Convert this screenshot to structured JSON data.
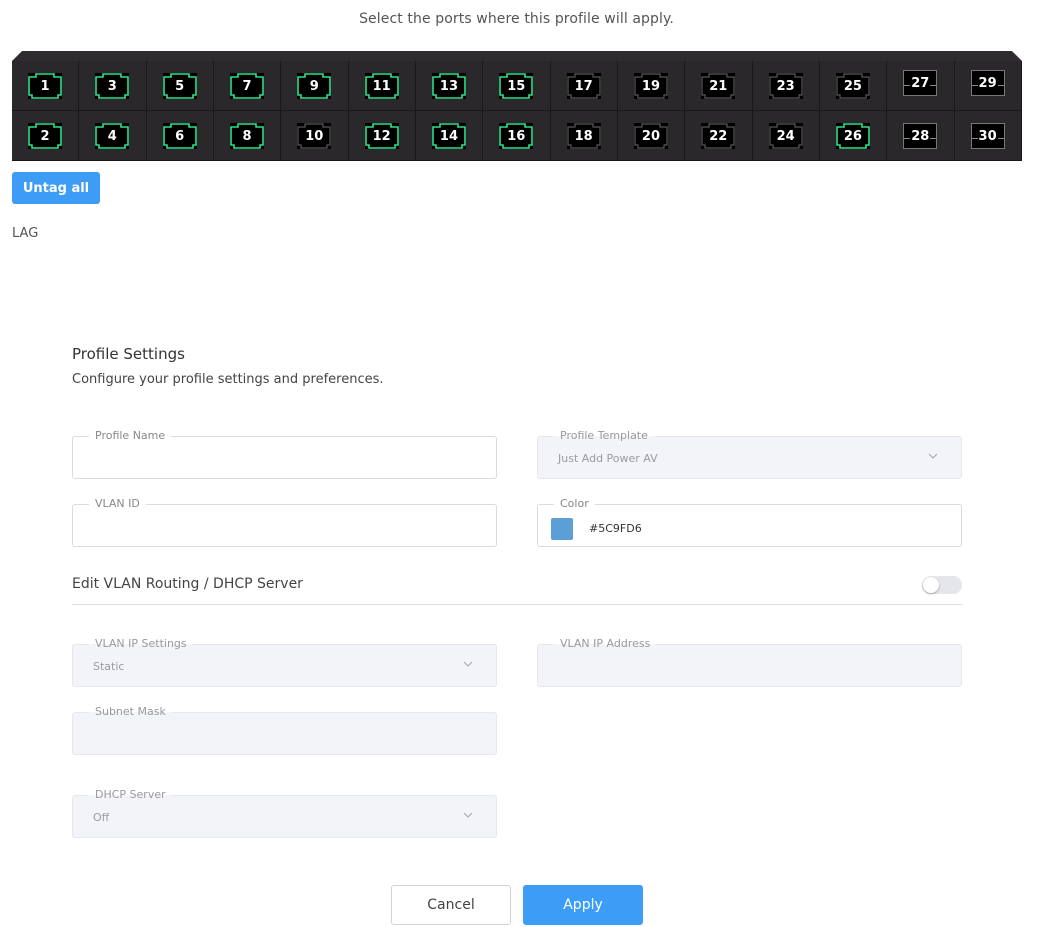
{
  "header": {
    "instruction": "Select the ports where this profile will apply."
  },
  "ports": {
    "top_row": [
      {
        "label": "1",
        "selected": true,
        "kind": "rj45"
      },
      {
        "label": "3",
        "selected": true,
        "kind": "rj45"
      },
      {
        "label": "5",
        "selected": true,
        "kind": "rj45"
      },
      {
        "label": "7",
        "selected": true,
        "kind": "rj45"
      },
      {
        "label": "9",
        "selected": true,
        "kind": "rj45"
      },
      {
        "label": "11",
        "selected": true,
        "kind": "rj45"
      },
      {
        "label": "13",
        "selected": true,
        "kind": "rj45"
      },
      {
        "label": "15",
        "selected": true,
        "kind": "rj45"
      },
      {
        "label": "17",
        "selected": false,
        "kind": "rj45"
      },
      {
        "label": "19",
        "selected": false,
        "kind": "rj45"
      },
      {
        "label": "21",
        "selected": false,
        "kind": "rj45"
      },
      {
        "label": "23",
        "selected": false,
        "kind": "rj45"
      },
      {
        "label": "25",
        "selected": false,
        "kind": "rj45"
      },
      {
        "label": "27",
        "selected": false,
        "kind": "sfp"
      },
      {
        "label": "29",
        "selected": false,
        "kind": "sfp"
      }
    ],
    "bottom_row": [
      {
        "label": "2",
        "selected": true,
        "kind": "rj45"
      },
      {
        "label": "4",
        "selected": true,
        "kind": "rj45"
      },
      {
        "label": "6",
        "selected": true,
        "kind": "rj45"
      },
      {
        "label": "8",
        "selected": true,
        "kind": "rj45"
      },
      {
        "label": "10",
        "selected": false,
        "kind": "rj45"
      },
      {
        "label": "12",
        "selected": true,
        "kind": "rj45"
      },
      {
        "label": "14",
        "selected": true,
        "kind": "rj45"
      },
      {
        "label": "16",
        "selected": true,
        "kind": "rj45"
      },
      {
        "label": "18",
        "selected": false,
        "kind": "rj45"
      },
      {
        "label": "20",
        "selected": false,
        "kind": "rj45"
      },
      {
        "label": "22",
        "selected": false,
        "kind": "rj45"
      },
      {
        "label": "24",
        "selected": false,
        "kind": "rj45"
      },
      {
        "label": "26",
        "selected": true,
        "kind": "rj45"
      },
      {
        "label": "28",
        "selected": false,
        "kind": "sfp"
      },
      {
        "label": "30",
        "selected": false,
        "kind": "sfp"
      }
    ],
    "selected_color": "#2ee08a",
    "unselected_color": "#5a585a"
  },
  "actions": {
    "untag_all_label": "Untag all"
  },
  "lag": {
    "label": "LAG"
  },
  "profile_settings": {
    "title": "Profile Settings",
    "subtitle": "Configure your profile settings and preferences.",
    "profile_name": {
      "label": "Profile Name",
      "value": ""
    },
    "profile_template": {
      "label": "Profile Template",
      "value": "Just Add Power AV",
      "icon": "chevron-down-icon"
    },
    "vlan_id": {
      "label": "VLAN ID",
      "value": ""
    },
    "color": {
      "label": "Color",
      "value": "#5C9FD6",
      "swatch": "#5c9fd6"
    },
    "routing_toggle": {
      "label": "Edit VLAN Routing / DHCP Server",
      "on": false
    },
    "vlan_ip_settings": {
      "label": "VLAN IP Settings",
      "value": "Static",
      "icon": "chevron-down-icon"
    },
    "vlan_ip_address": {
      "label": "VLAN IP Address",
      "value": ""
    },
    "subnet_mask": {
      "label": "Subnet Mask",
      "value": ""
    },
    "dhcp_server": {
      "label": "DHCP Server",
      "value": "Off",
      "icon": "chevron-down-icon"
    }
  },
  "footer": {
    "cancel_label": "Cancel",
    "apply_label": "Apply"
  },
  "colors": {
    "accent": "#3d9df6",
    "panel": "#262426"
  }
}
